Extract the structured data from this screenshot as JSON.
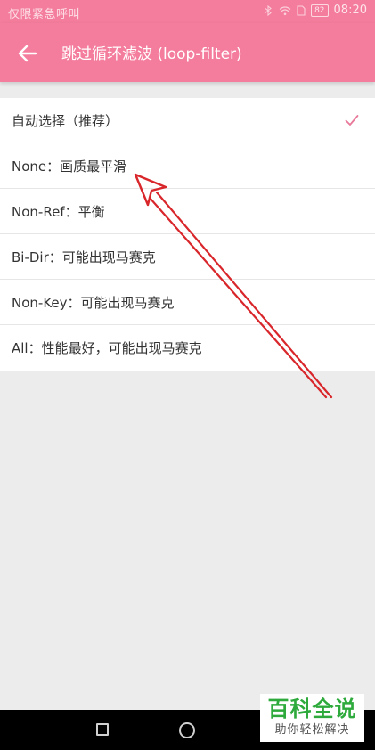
{
  "status_bar": {
    "carrier_text": "仅限紧急呼叫",
    "battery": "82",
    "time": "08:20"
  },
  "app_bar": {
    "title": "跳过循环滤波 (loop-filter)",
    "back_icon": "arrow-left-icon"
  },
  "options": [
    {
      "label": "自动选择（推荐）",
      "selected": true
    },
    {
      "label": "None：画质最平滑",
      "selected": false
    },
    {
      "label": "Non-Ref：平衡",
      "selected": false
    },
    {
      "label": "Bi-Dir：可能出现马赛克",
      "selected": false
    },
    {
      "label": "Non-Key：可能出现马赛克",
      "selected": false
    },
    {
      "label": "All：性能最好，可能出现马赛克",
      "selected": false
    }
  ],
  "colors": {
    "accent": "#f47c9c",
    "check": "#e8799a",
    "annotation": "#d8262b",
    "watermark_green": "#2eaa3c"
  },
  "watermark": {
    "title": "百科全说",
    "subtitle": "助你轻松解决"
  }
}
